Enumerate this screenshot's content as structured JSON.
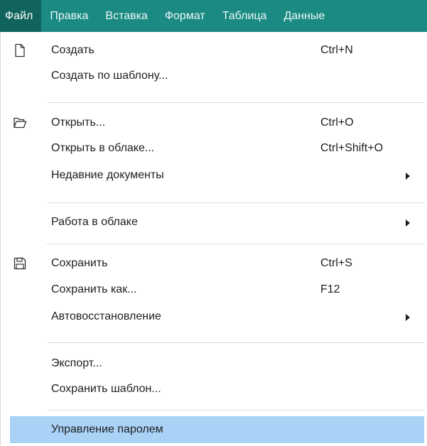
{
  "menubar": {
    "items": [
      {
        "label": "Файл"
      },
      {
        "label": "Правка"
      },
      {
        "label": "Вставка"
      },
      {
        "label": "Формат"
      },
      {
        "label": "Таблица"
      },
      {
        "label": "Данные"
      }
    ]
  },
  "file_menu": {
    "items": [
      {
        "label": "Создать",
        "shortcut": "Ctrl+N",
        "icon": "new-document-icon"
      },
      {
        "label": "Создать по шаблону...",
        "shortcut": ""
      },
      {
        "label": "Открыть...",
        "shortcut": "Ctrl+O",
        "icon": "open-folder-icon"
      },
      {
        "label": "Открыть в облаке...",
        "shortcut": "Ctrl+Shift+O"
      },
      {
        "label": "Недавние документы",
        "shortcut": "",
        "submenu": true
      },
      {
        "label": "Работа в облаке",
        "shortcut": "",
        "submenu": true
      },
      {
        "label": "Сохранить",
        "shortcut": "Ctrl+S",
        "icon": "save-icon"
      },
      {
        "label": "Сохранить как...",
        "shortcut": "F12"
      },
      {
        "label": "Автовосстановление",
        "shortcut": "",
        "submenu": true
      },
      {
        "label": "Экспорт...",
        "shortcut": ""
      },
      {
        "label": "Сохранить шаблон...",
        "shortcut": ""
      },
      {
        "label": "Управление паролем",
        "shortcut": "",
        "highlighted": true
      }
    ]
  },
  "colors": {
    "menubar_bg": "#1a8a82",
    "menubar_active_bg": "#11635d",
    "highlight_bg": "#a9d2f6"
  }
}
